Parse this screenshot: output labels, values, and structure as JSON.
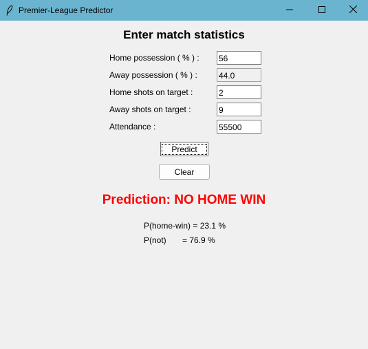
{
  "window": {
    "title": "Premier-League Predictor",
    "icon": "feather-icon",
    "controls": [
      "minimize-icon",
      "maximize-icon",
      "close-icon"
    ]
  },
  "form": {
    "heading": "Enter match statistics",
    "fields": [
      {
        "label": "Home possession ( % ) :",
        "value": "56",
        "readonly": false
      },
      {
        "label": "Away possession ( % ) :",
        "value": "44.0",
        "readonly": true
      },
      {
        "label": "Home shots on target :",
        "value": "2",
        "readonly": false
      },
      {
        "label": "Away shots on target :",
        "value": "9",
        "readonly": false
      },
      {
        "label": "Attendance :",
        "value": "55500",
        "readonly": false
      }
    ],
    "predict_label": "Predict",
    "clear_label": "Clear"
  },
  "result": {
    "prediction": "Prediction: NO HOME WIN",
    "prediction_color": "#ff0000",
    "p_home_win": "P(home-win) = 23.1 %",
    "p_not": "P(not)       = 76.9 %"
  },
  "colors": {
    "titlebar": "#6ab4d0",
    "background": "#f0f0f0"
  }
}
